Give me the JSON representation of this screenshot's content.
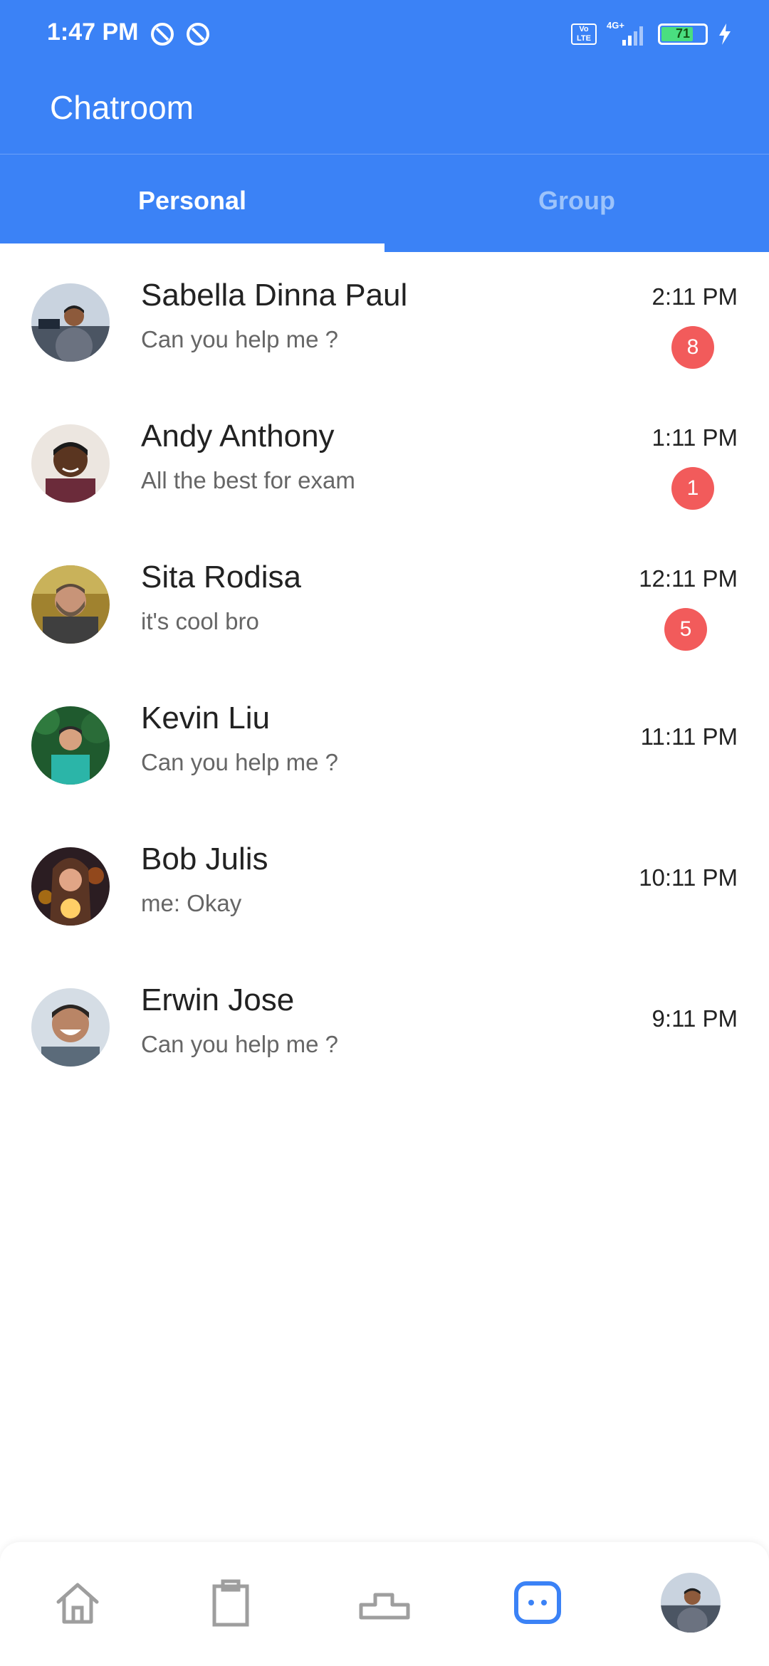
{
  "status_bar": {
    "time": "1:47 PM",
    "battery": "71",
    "network": "4G+",
    "volte": "Vo LTE"
  },
  "header": {
    "title": "Chatroom"
  },
  "tabs": [
    {
      "label": "Personal",
      "active": true
    },
    {
      "label": "Group",
      "active": false
    }
  ],
  "chats": [
    {
      "name": "Sabella Dinna Paul",
      "message": "Can you help me ?",
      "time": "2:11 PM",
      "unread": "8",
      "avatar": "man-suit"
    },
    {
      "name": "Andy Anthony",
      "message": "All the best for exam",
      "time": "1:11 PM",
      "unread": "1",
      "avatar": "man-smile"
    },
    {
      "name": "Sita Rodisa",
      "message": "it's cool bro",
      "time": "12:11 PM",
      "unread": "5",
      "avatar": "man-beard"
    },
    {
      "name": "Kevin Liu",
      "message": "Can you help me ?",
      "time": "11:11 PM",
      "unread": "",
      "avatar": "man-green"
    },
    {
      "name": "Bob Julis",
      "message": "me: Okay",
      "time": "10:11 PM",
      "unread": "",
      "avatar": "woman-lights"
    },
    {
      "name": "Erwin Jose",
      "message": "Can you help me ?",
      "time": "9:11 PM",
      "unread": "",
      "avatar": "man-laugh"
    }
  ],
  "bottom_nav": [
    {
      "icon": "home-icon",
      "active": false
    },
    {
      "icon": "clipboard-icon",
      "active": false
    },
    {
      "icon": "podium-icon",
      "active": false
    },
    {
      "icon": "chat-icon",
      "active": true
    },
    {
      "icon": "profile-avatar",
      "active": false
    }
  ],
  "colors": {
    "primary": "#3b82f6",
    "badge": "#f25b5b",
    "inactive_tab": "#9cc3fb",
    "nav_inactive": "#9e9e9e"
  }
}
